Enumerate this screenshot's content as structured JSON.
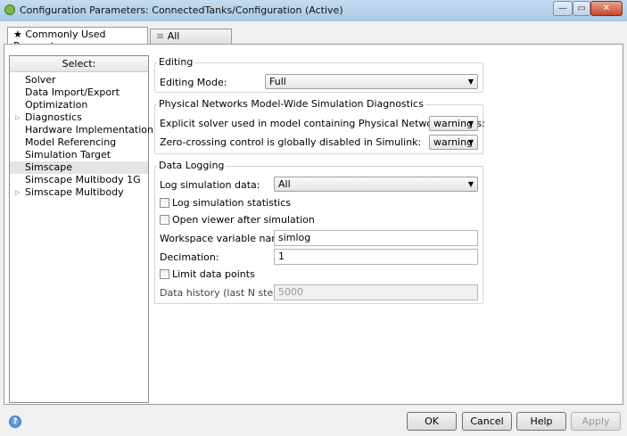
{
  "window": {
    "title": "Configuration Parameters: ConnectedTanks/Configuration (Active)",
    "minimize": "—",
    "maximize": "▭",
    "close": "✕"
  },
  "tabs": [
    {
      "icon": "★",
      "label": "Commonly Used Parameters"
    },
    {
      "icon": "≡",
      "label": "All Parameters"
    }
  ],
  "sidebar": {
    "header": "Select:",
    "items": [
      {
        "label": "Solver"
      },
      {
        "label": "Data Import/Export"
      },
      {
        "label": "Optimization"
      },
      {
        "label": "Diagnostics",
        "expandable": true
      },
      {
        "label": "Hardware Implementation"
      },
      {
        "label": "Model Referencing"
      },
      {
        "label": "Simulation Target"
      },
      {
        "label": "Simscape",
        "selected": true
      },
      {
        "label": "Simscape Multibody 1G"
      },
      {
        "label": "Simscape Multibody",
        "expandable": true
      }
    ]
  },
  "editing": {
    "title": "Editing",
    "mode_label": "Editing Mode:",
    "mode_value": "Full"
  },
  "diagnostics": {
    "title": "Physical Networks Model-Wide Simulation Diagnostics",
    "explicit_label": "Explicit solver used in model containing Physical Networks blocks:",
    "explicit_value": "warning",
    "zc_label": "Zero-crossing control is globally disabled in Simulink:",
    "zc_value": "warning"
  },
  "logging": {
    "title": "Data Logging",
    "log_label": "Log simulation data:",
    "log_value": "All",
    "stats_label": "Log simulation statistics",
    "viewer_label": "Open viewer after simulation",
    "ws_label": "Workspace variable name:",
    "ws_value": "simlog",
    "dec_label": "Decimation:",
    "dec_value": "1",
    "limit_label": "Limit data points",
    "hist_label": "Data history (last N steps):",
    "hist_value": "5000"
  },
  "buttons": {
    "ok": "OK",
    "cancel": "Cancel",
    "help": "Help",
    "apply": "Apply",
    "help_icon": "?"
  }
}
